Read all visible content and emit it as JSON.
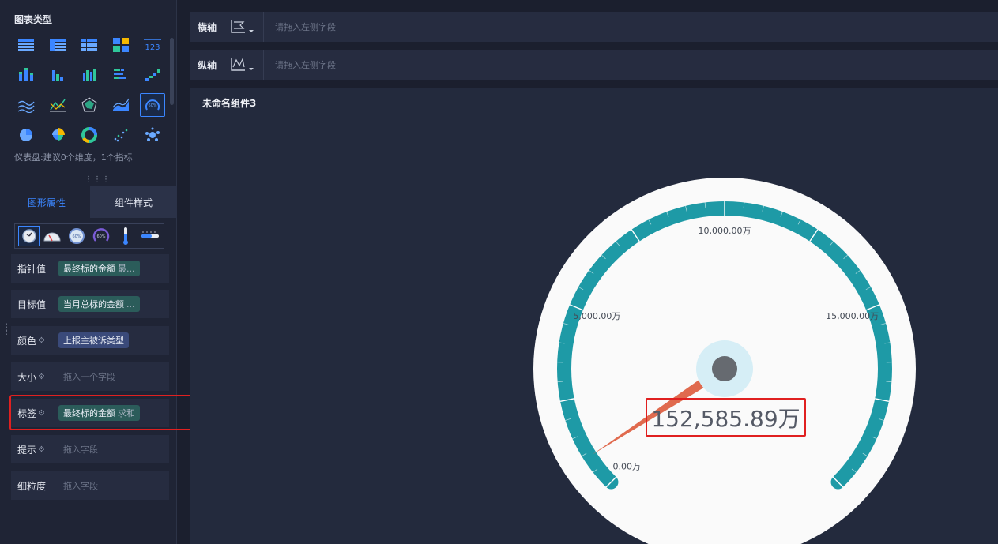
{
  "left_panel": {
    "chart_types_title": "图表类型",
    "chart_type_hint": "仪表盘:建议0个维度，1个指标",
    "chart_types": [
      {
        "icon": "table-icon"
      },
      {
        "icon": "cross-table-icon"
      },
      {
        "icon": "grid-table-icon"
      },
      {
        "icon": "heat-table-icon"
      },
      {
        "icon": "kpi-number-icon",
        "text": "123"
      },
      {
        "icon": "stacked-bar-icon"
      },
      {
        "icon": "grouped-bar-icon"
      },
      {
        "icon": "bar-chart-icon"
      },
      {
        "icon": "horizontal-bar-icon"
      },
      {
        "icon": "step-bar-icon"
      },
      {
        "icon": "line-chart-icon"
      },
      {
        "icon": "combo-line-icon"
      },
      {
        "icon": "radar-icon"
      },
      {
        "icon": "area-chart-icon"
      },
      {
        "icon": "gauge-icon",
        "selected": true
      },
      {
        "icon": "pie-chart-icon"
      },
      {
        "icon": "rose-pie-icon"
      },
      {
        "icon": "donut-chart-icon"
      },
      {
        "icon": "scatter-icon"
      },
      {
        "icon": "bubble-icon"
      }
    ],
    "tabs": [
      {
        "label": "图形属性",
        "active": true
      },
      {
        "label": "组件样式",
        "active": false
      }
    ],
    "gauge_styles": [
      "clock-gauge-icon",
      "semicircle-gauge-icon",
      "ring-gauge-icon",
      "arc-gauge-icon",
      "thermometer-icon",
      "slider-gauge-icon"
    ],
    "fields": [
      {
        "label": "指针值",
        "gear": false,
        "pill": "最终标的金额",
        "pill_suffix": "最...",
        "pill_color": "green"
      },
      {
        "label": "目标值",
        "gear": false,
        "pill": "当月总标的金额",
        "pill_suffix": "...",
        "pill_color": "green"
      },
      {
        "label": "颜色",
        "gear": true,
        "pill": "上报主被诉类型",
        "pill_suffix": "",
        "pill_color": "blue"
      },
      {
        "label": "大小",
        "gear": true,
        "placeholder": "拖入一个字段"
      },
      {
        "label": "标签",
        "gear": true,
        "pill": "最终标的金额",
        "pill_suffix": "求和",
        "pill_color": "green"
      },
      {
        "label": "提示",
        "gear": true,
        "placeholder": "拖入字段"
      },
      {
        "label": "细粒度",
        "gear": false,
        "placeholder": "拖入字段"
      }
    ]
  },
  "axes": {
    "x_label": "横轴",
    "y_label": "纵轴",
    "x_placeholder": "请拖入左侧字段",
    "y_placeholder": "请拖入左侧字段"
  },
  "widget": {
    "title": "未命名组件3"
  },
  "chart_data": {
    "type": "gauge",
    "min": 0,
    "max": 20000,
    "unit": "万",
    "tick_labels": [
      "0.00万",
      "5,000.00万",
      "10,000.00万",
      "15,000.00万"
    ],
    "tick_values": [
      0,
      5000,
      10000,
      15000
    ],
    "value": 152585.89,
    "value_label": "152,585.89万",
    "arc_color": "#1e9aa6",
    "pointer_color": "#e06a4e"
  }
}
